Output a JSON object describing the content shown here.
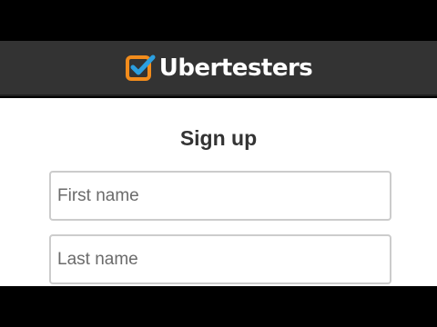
{
  "header": {
    "brand": "Ubertesters",
    "logo_icon": "checkbox-check-icon",
    "logo_colors": {
      "box": "#f28c1c",
      "check": "#2b9fe0"
    },
    "background": "#333333"
  },
  "form": {
    "title": "Sign up",
    "first_name": {
      "placeholder": "First name",
      "value": ""
    },
    "last_name": {
      "placeholder": "Last name",
      "value": ""
    }
  }
}
